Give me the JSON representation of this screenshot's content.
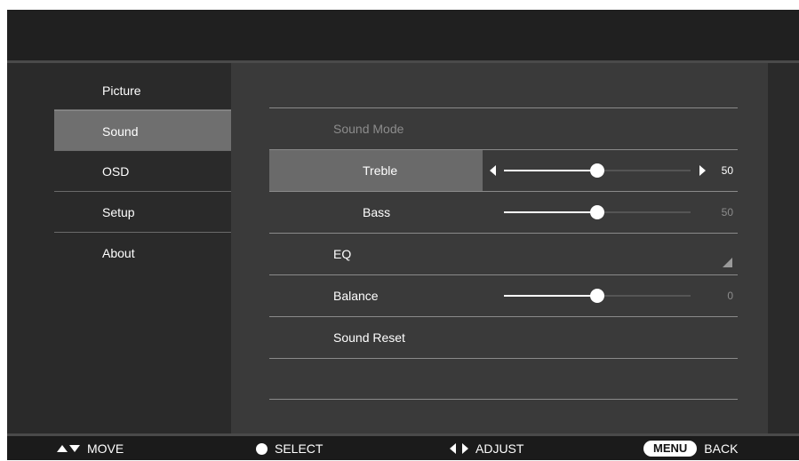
{
  "nav": {
    "items": [
      {
        "label": "Picture"
      },
      {
        "label": "Sound"
      },
      {
        "label": "OSD"
      },
      {
        "label": "Setup"
      },
      {
        "label": "About"
      }
    ],
    "selected": "Sound"
  },
  "sound": {
    "sound_mode": {
      "label": "Sound Mode"
    },
    "treble": {
      "label": "Treble",
      "value": "50",
      "level": 0.5
    },
    "bass": {
      "label": "Bass",
      "value": "50",
      "level": 0.5
    },
    "eq": {
      "label": "EQ"
    },
    "balance": {
      "label": "Balance",
      "value": "0",
      "level": 0.5
    },
    "sound_reset": {
      "label": "Sound Reset"
    }
  },
  "hints": {
    "move": "MOVE",
    "select": "SELECT",
    "adjust": "ADJUST",
    "menu_key": "MENU",
    "back": "BACK"
  },
  "icons": [
    "up-arrow-icon",
    "down-arrow-icon",
    "select-dot-icon",
    "left-arrow-icon",
    "right-arrow-icon",
    "eq-corner-icon"
  ],
  "colors": {
    "background": "#2a2a2a",
    "panel": "#3a3a3a",
    "highlight": "#6a6a6a",
    "text": "#ffffff",
    "disabled_text": "#8c8c8c"
  }
}
